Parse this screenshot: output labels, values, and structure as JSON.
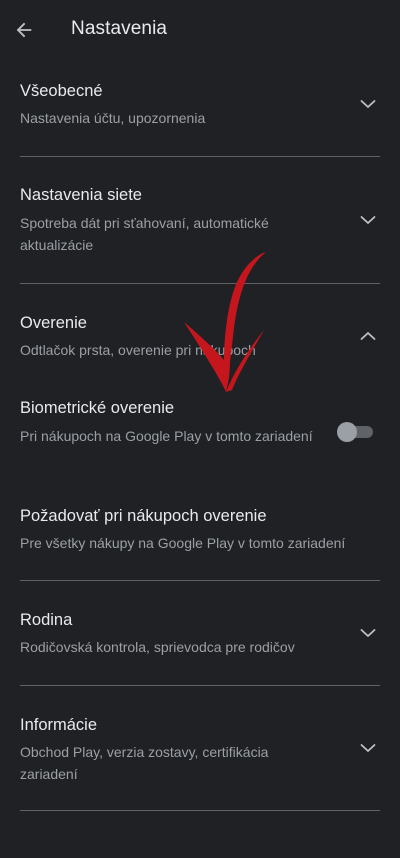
{
  "app_bar": {
    "title": "Nastavenia",
    "back_icon": "arrow-back-icon"
  },
  "sections": {
    "general": {
      "title": "Všeobecné",
      "subtitle": "Nastavenia účtu, upozornenia",
      "icon": "chevron-down-icon"
    },
    "network": {
      "title": "Nastavenia siete",
      "subtitle": "Spotreba dát pri sťahovaní, automatické aktualizácie",
      "icon": "chevron-down-icon"
    },
    "auth": {
      "title": "Overenie",
      "subtitle": "Odtlačok prsta, overenie pri nákupoch",
      "icon": "chevron-up-icon",
      "items": {
        "biometric": {
          "title": "Biometrické overenie",
          "subtitle": "Pri nákupoch na Google Play v tomto zariadení",
          "enabled": false
        },
        "require": {
          "title": "Požadovať pri nákupoch overenie",
          "subtitle": "Pre všetky nákupy na Google Play v tomto zariadení"
        }
      }
    },
    "family": {
      "title": "Rodina",
      "subtitle": "Rodičovská kontrola, sprievodca pre rodičov",
      "icon": "chevron-down-icon"
    },
    "about": {
      "title": "Informácie",
      "subtitle": "Obchod Play, verzia zostavy, certifikácia zariadení",
      "icon": "chevron-down-icon"
    }
  },
  "colors": {
    "background": "#202124",
    "text_primary": "#e8eaed",
    "text_secondary": "#9aa0a6",
    "divider": "#5f6368",
    "annotation_arrow": "#c5161d"
  }
}
